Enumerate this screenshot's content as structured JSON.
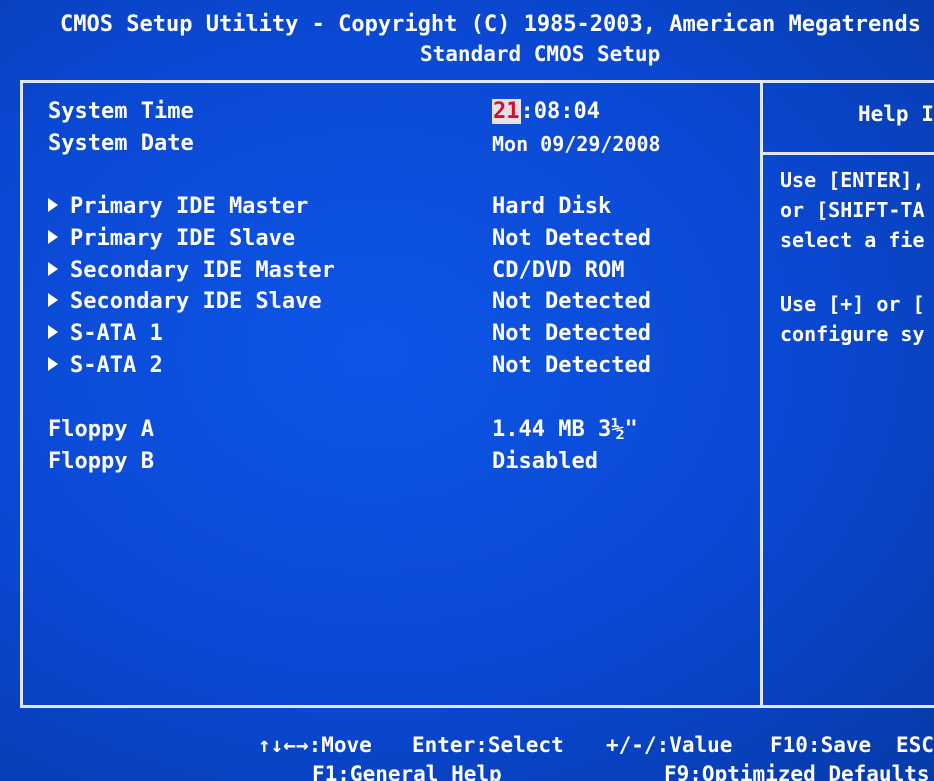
{
  "header": {
    "title": "CMOS Setup Utility - Copyright (C) 1985-2003, American Megatrends",
    "subtitle": "Standard CMOS Setup"
  },
  "system": {
    "time_label": "System Time",
    "time_hours": "21",
    "time_rest": ":08:04",
    "date_label": "System Date",
    "date_value": "Mon 09/29/2008"
  },
  "drives": [
    {
      "label": "Primary IDE Master",
      "value": "Hard Disk"
    },
    {
      "label": "Primary IDE Slave",
      "value": "Not Detected"
    },
    {
      "label": "Secondary IDE Master",
      "value": "CD/DVD ROM"
    },
    {
      "label": "Secondary IDE Slave",
      "value": "Not Detected"
    },
    {
      "label": "S-ATA 1",
      "value": "Not Detected"
    },
    {
      "label": "S-ATA 2",
      "value": "Not Detected"
    }
  ],
  "floppy": {
    "a_label": "Floppy A",
    "a_value": "1.44 MB 3½\"",
    "b_label": "Floppy B",
    "b_value": "Disabled"
  },
  "help": {
    "title": "Help I",
    "line1": "Use [ENTER],",
    "line2": "or [SHIFT-TA",
    "line3": "select a fie",
    "line4": "Use [+] or [",
    "line5": "configure sy"
  },
  "footer": {
    "move": "↑↓←→:Move",
    "select": "Enter:Select",
    "value": "+/-/:Value",
    "save": "F10:Save",
    "esc": "ESC",
    "general_help": "F1:General Help",
    "defaults": "F9:Optimized Defaults"
  },
  "colors": {
    "background": "#0a46c8",
    "text": "#ffffff",
    "cursor_bg": "#e8e0e8",
    "cursor_fg": "#d0102c"
  }
}
